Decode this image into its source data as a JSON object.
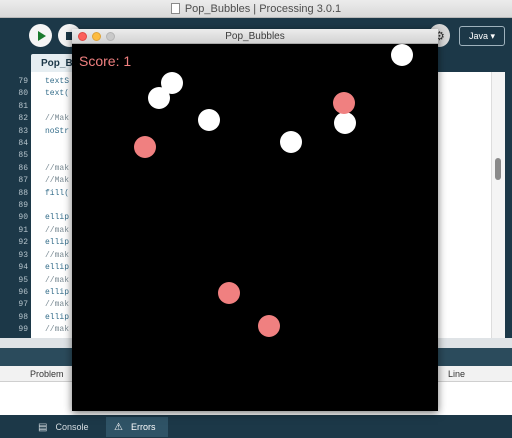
{
  "ide": {
    "title": "Pop_Bubbles | Processing 3.0.1",
    "mode": "Java ▾",
    "tab_label": "Pop_B",
    "line_numbers": [
      "79",
      "80",
      "81",
      "82",
      "83",
      "84",
      "85",
      "86",
      "87",
      "88",
      "89",
      "90",
      "91",
      "92",
      "93",
      "94",
      "95",
      "96",
      "97",
      "98",
      "99",
      "100"
    ],
    "code_lines": [
      {
        "text": "textS",
        "comment": false
      },
      {
        "text": "text(",
        "comment": false
      },
      {
        "text": "",
        "comment": false
      },
      {
        "text": "//Mak",
        "comment": true
      },
      {
        "text": "noStr",
        "comment": false
      },
      {
        "text": "",
        "comment": false
      },
      {
        "text": "",
        "comment": false
      },
      {
        "text": "//mak",
        "comment": true
      },
      {
        "text": "//Mak",
        "comment": true
      },
      {
        "text": "fill(",
        "comment": false
      },
      {
        "text": "",
        "comment": false
      },
      {
        "text": "ellip",
        "comment": false
      },
      {
        "text": "//mak",
        "comment": true
      },
      {
        "text": "ellip",
        "comment": false
      },
      {
        "text": "//mak",
        "comment": true
      },
      {
        "text": "ellip",
        "comment": false
      },
      {
        "text": "//mak",
        "comment": true
      },
      {
        "text": "ellip",
        "comment": false
      },
      {
        "text": "//mak",
        "comment": true
      },
      {
        "text": "ellip",
        "comment": false
      },
      {
        "text": "//mak",
        "comment": true
      },
      {
        "text": "ellip",
        "comment": false
      }
    ],
    "problems_columns": {
      "problem": "Problem",
      "line": "Line"
    },
    "bottom_tabs": {
      "console": "Console",
      "errors": "Errors"
    },
    "icons": {
      "run": "play-icon",
      "stop": "stop-icon",
      "debug": "debug-icon",
      "console": "console-icon",
      "errors": "warning-icon"
    }
  },
  "sketch": {
    "title": "Pop_Bubbles",
    "score": "Score: 1",
    "colors": {
      "white_bubble": "#ffffff",
      "pink_bubble": "#f08080",
      "background": "#000000"
    },
    "bubbles": [
      {
        "color": "white",
        "kind": "white-bubble"
      },
      {
        "color": "white",
        "kind": "white-bubble"
      },
      {
        "color": "white",
        "kind": "white-bubble"
      },
      {
        "color": "white",
        "kind": "white-bubble"
      },
      {
        "color": "white",
        "kind": "white-bubble"
      },
      {
        "color": "white",
        "kind": "white-bubble"
      },
      {
        "color": "pink",
        "kind": "pink-bubble"
      },
      {
        "color": "pink",
        "kind": "pink-bubble"
      },
      {
        "color": "pink",
        "kind": "pink-bubble"
      },
      {
        "color": "pink",
        "kind": "pink-bubble"
      }
    ]
  }
}
